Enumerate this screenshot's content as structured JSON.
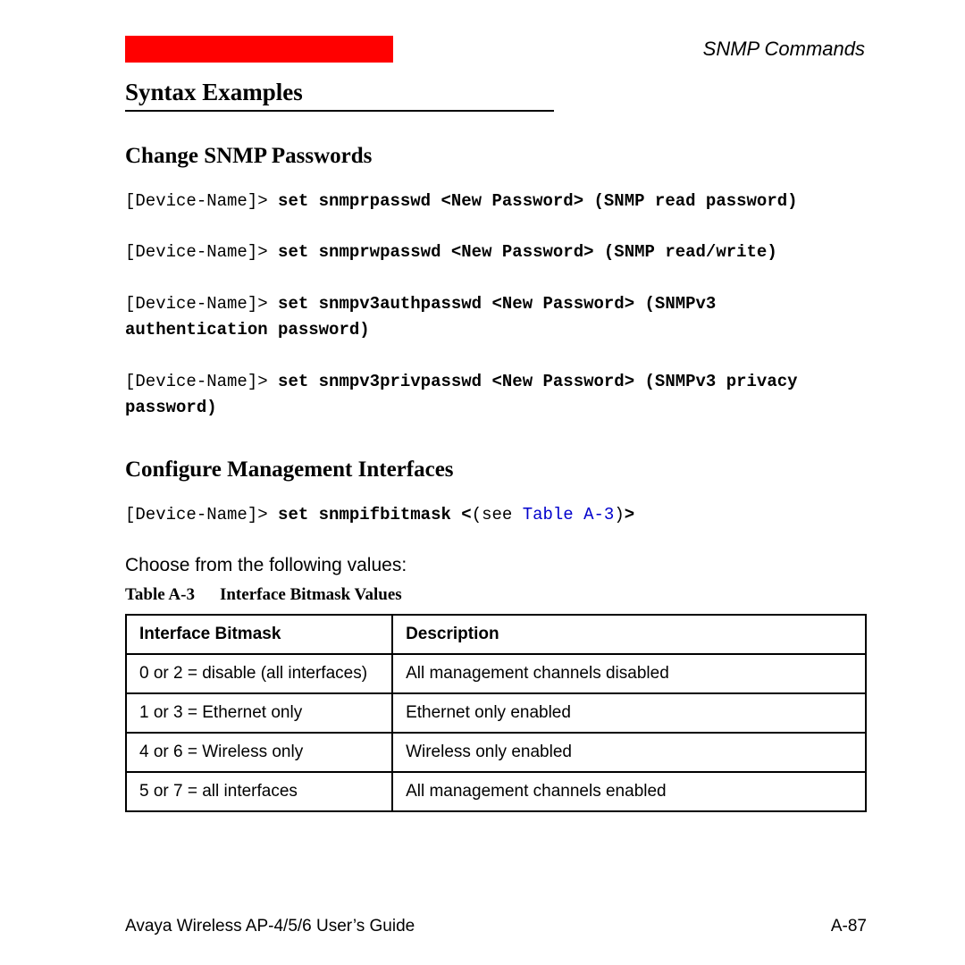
{
  "header": {
    "right_label": "SNMP Commands"
  },
  "h1": "Syntax Examples",
  "section1": {
    "title": "Change SNMP Passwords",
    "prompt": "[Device-Name]>",
    "cmds": [
      {
        "bold": "set snmprpasswd <New Password> (SNMP read password)"
      },
      {
        "bold": "set snmprwpasswd <New Password> (SNMP read/write)"
      },
      {
        "bold": "set snmpv3authpasswd <New Password> (SNMPv3 authentication password)"
      },
      {
        "bold": "set snmpv3privpasswd <New Password> (SNMPv3 privacy password)"
      }
    ]
  },
  "section2": {
    "title": "Configure Management Interfaces",
    "prompt": "[Device-Name]>",
    "cmd_bold_pre": "set snmpifbitmask <",
    "cmd_see": "(see ",
    "cmd_link": "Table A-3",
    "cmd_after": ")",
    "cmd_bold_post": ">",
    "body": "Choose from the following values:",
    "table_label": "Table  A-3",
    "table_title": "Interface Bitmask Values",
    "headers": {
      "c1": "Interface Bitmask",
      "c2": "Description"
    },
    "rows": [
      {
        "c1": "0 or 2 = disable (all interfaces)",
        "c2": "All management channels disabled"
      },
      {
        "c1": "1 or 3 = Ethernet only",
        "c2": "Ethernet only enabled"
      },
      {
        "c1": "4 or 6 = Wireless only",
        "c2": "Wireless only enabled"
      },
      {
        "c1": "5 or 7 = all interfaces",
        "c2": "All management channels enabled"
      }
    ]
  },
  "footer": {
    "left": "Avaya Wireless AP-4/5/6 User’s Guide",
    "right": "A-87"
  }
}
